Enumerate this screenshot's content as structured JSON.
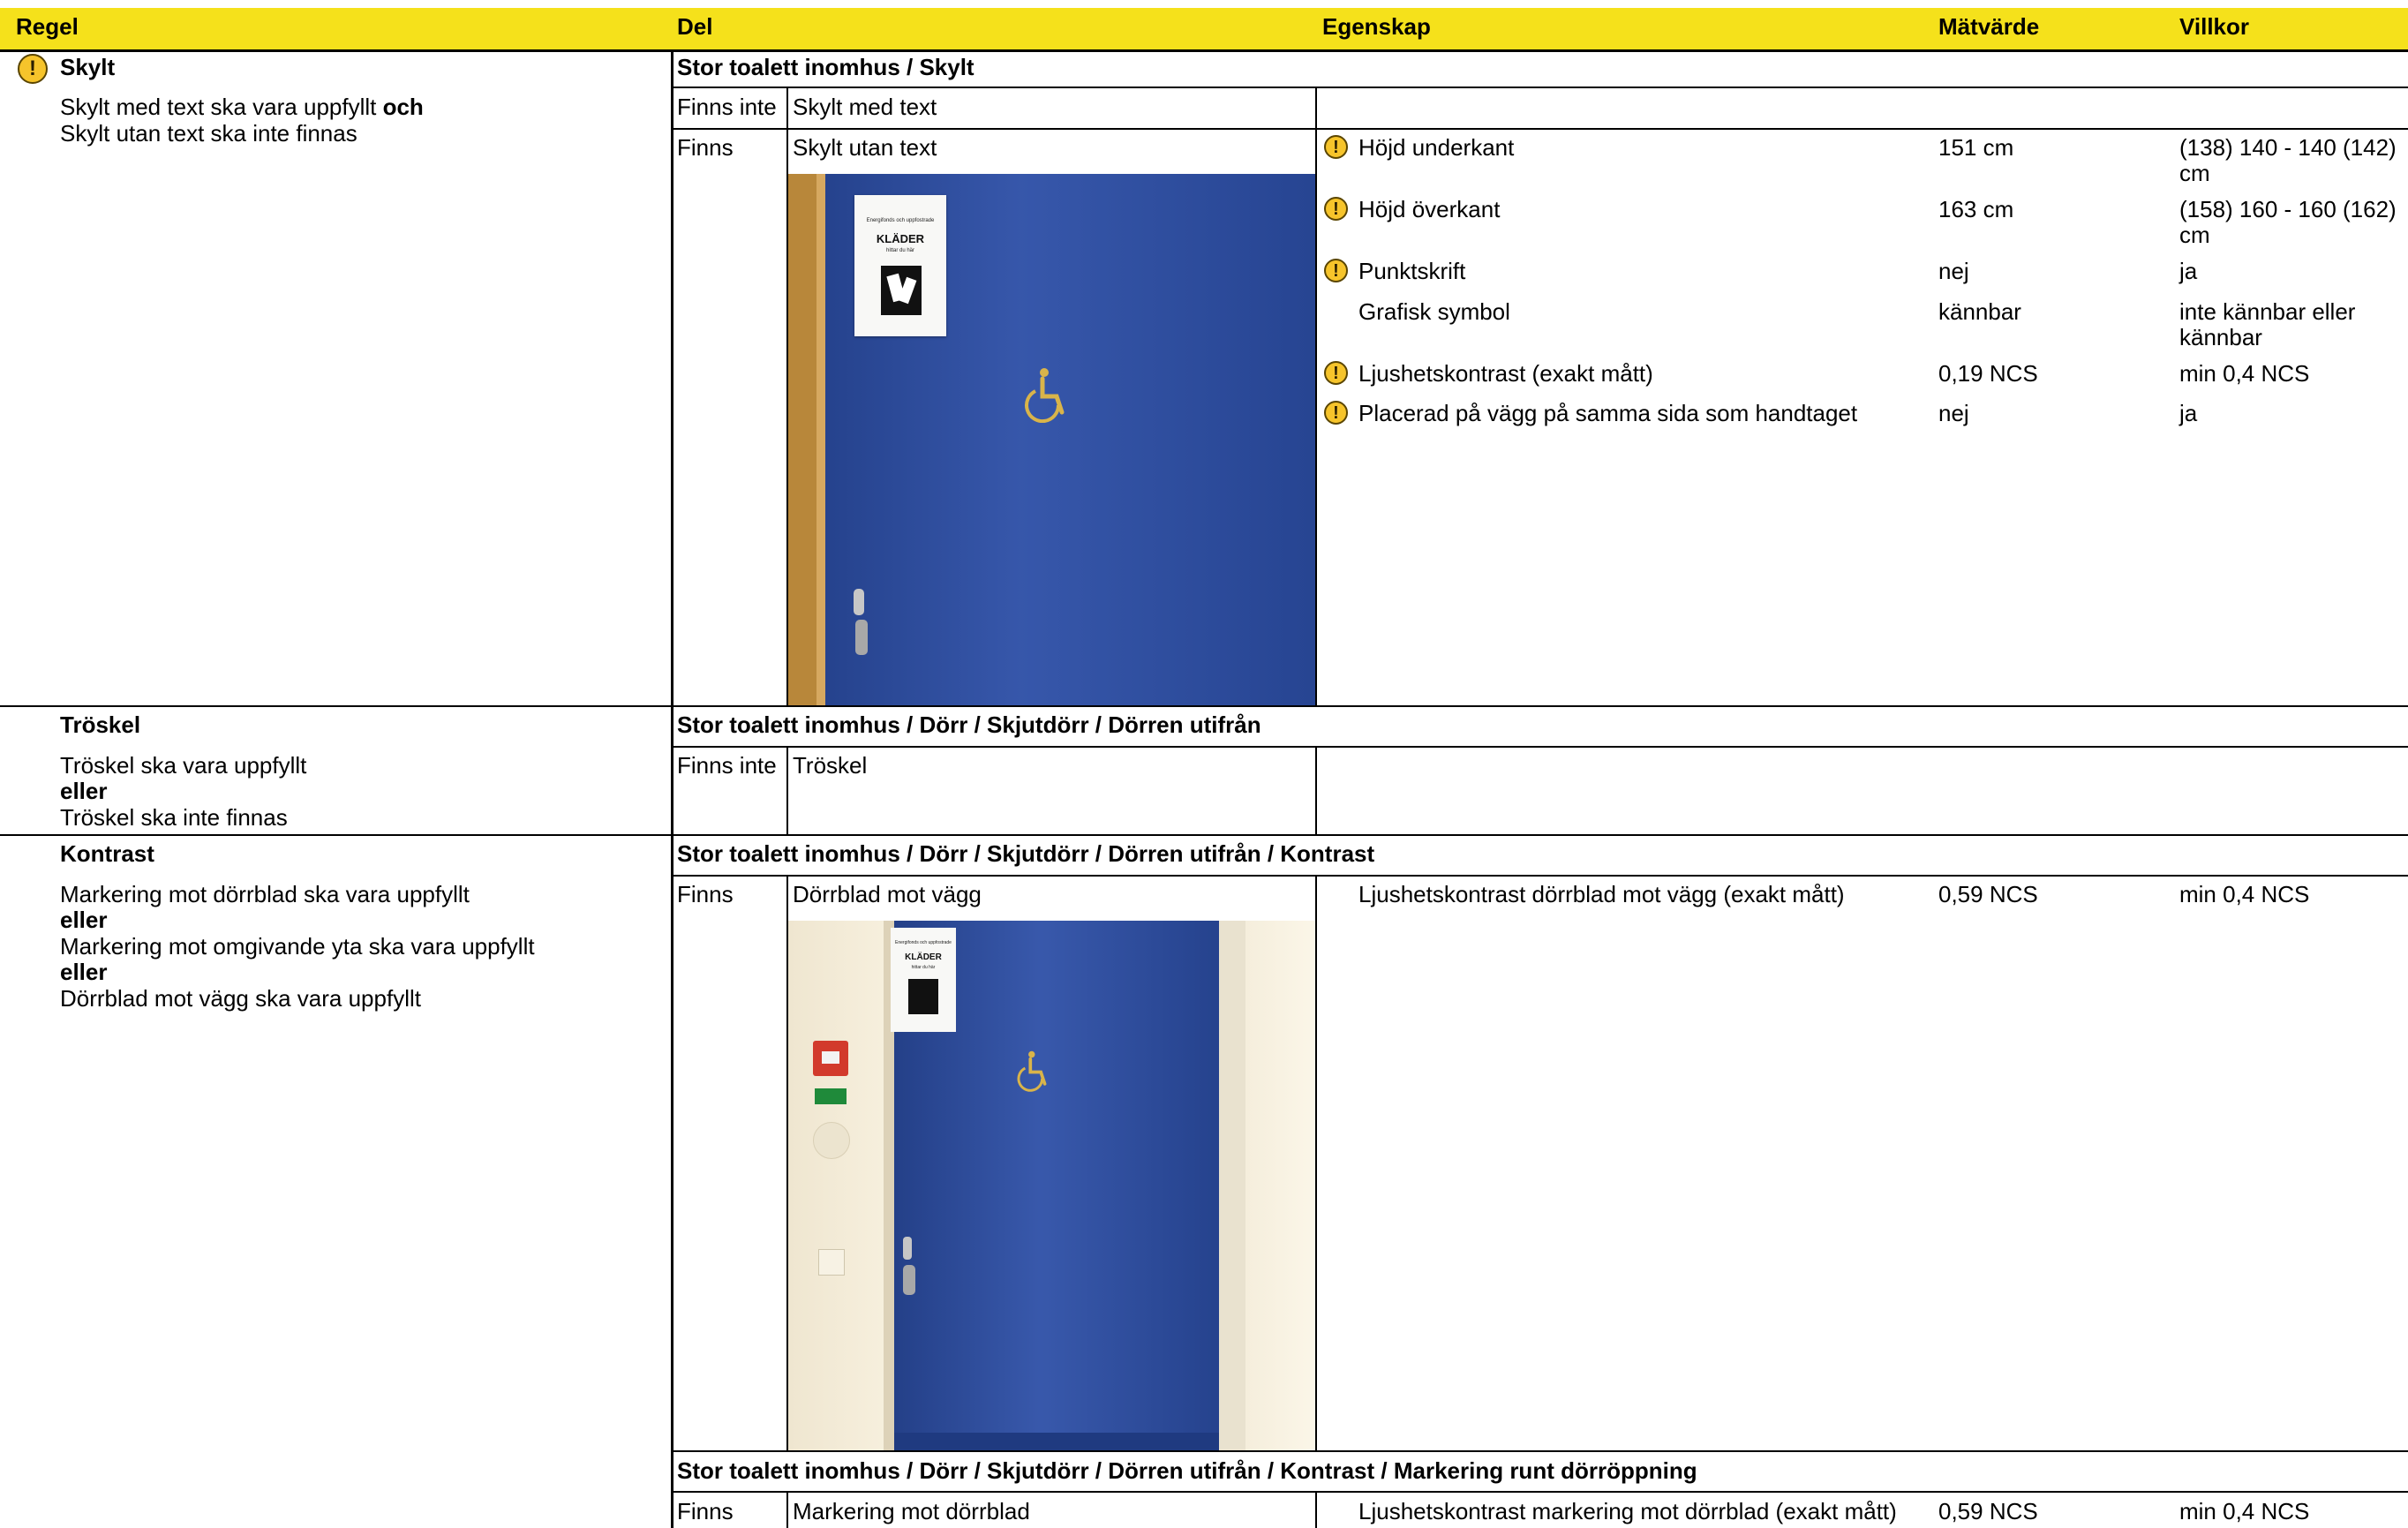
{
  "header": {
    "regel": "Regel",
    "del": "Del",
    "egenskap": "Egenskap",
    "matvarde": "Mätvärde",
    "villkor": "Villkor"
  },
  "rules": {
    "skylt": {
      "title": "Skylt",
      "line1_a": "Skylt med text ska vara uppfyllt ",
      "line1_b": "och",
      "line2": "Skylt utan text ska inte finnas"
    },
    "troskel": {
      "title": "Tröskel",
      "line1": "Tröskel ska vara uppfyllt",
      "line2": "eller",
      "line3": "Tröskel ska inte finnas"
    },
    "kontrast": {
      "title": "Kontrast",
      "line1": "Markering mot dörrblad ska vara uppfyllt",
      "line2": "eller",
      "line3": "Markering mot omgivande yta ska vara uppfyllt",
      "line4": "eller",
      "line5": "Dörrblad mot vägg ska vara uppfyllt"
    }
  },
  "sections": {
    "skylt": {
      "path": "Stor toalett inomhus / Skylt",
      "row1": {
        "status": "Finns inte",
        "part": "Skylt med text"
      },
      "row2": {
        "status": "Finns",
        "part": "Skylt utan text"
      },
      "properties": [
        {
          "name": "Höjd underkant",
          "value": "151 cm",
          "cond1": "(138) 140 - 140 (142)",
          "cond2": "cm",
          "warn": true
        },
        {
          "name": "Höjd överkant",
          "value": "163 cm",
          "cond1": "(158) 160 - 160 (162)",
          "cond2": "cm",
          "warn": true
        },
        {
          "name": "Punktskrift",
          "value": "nej",
          "cond1": "ja",
          "cond2": "",
          "warn": true
        },
        {
          "name": "Grafisk symbol",
          "value": "kännbar",
          "cond1": "inte kännbar eller",
          "cond2": "kännbar",
          "warn": false
        },
        {
          "name": "Ljushetskontrast (exakt mått)",
          "value": "0,19 NCS",
          "cond1": "min 0,4 NCS",
          "cond2": "",
          "warn": true
        },
        {
          "name": "Placerad på vägg på samma sida som handtaget",
          "value": "nej",
          "cond1": "ja",
          "cond2": "",
          "warn": true
        }
      ]
    },
    "troskel": {
      "path": "Stor toalett inomhus / Dörr / Skjutdörr / Dörren utifrån",
      "row1": {
        "status": "Finns inte",
        "part": "Tröskel"
      }
    },
    "kontrast": {
      "path": "Stor toalett inomhus / Dörr / Skjutdörr / Dörren utifrån / Kontrast",
      "row1": {
        "status": "Finns",
        "part": "Dörrblad mot vägg"
      },
      "property": {
        "name": "Ljushetskontrast dörrblad mot vägg (exakt mått)",
        "value": "0,59 NCS",
        "cond": "min 0,4 NCS"
      }
    },
    "markering": {
      "path": "Stor toalett inomhus / Dörr / Skjutdörr / Dörren utifrån / Kontrast / Markering runt dörröppning",
      "row1": {
        "status": "Finns",
        "part": "Markering mot dörrblad"
      },
      "property": {
        "name": "Ljushetskontrast markering mot dörrblad (exakt mått)",
        "value": "0,59 NCS",
        "cond": "min 0,4 NCS"
      }
    }
  },
  "photos": {
    "sign_small": "Energifonds och uppfostrade",
    "sign_big": "KLÄDER",
    "sign_sub": "hittar du här"
  },
  "icons": {
    "warning": "!",
    "warning_name": "warning-icon"
  },
  "colors": {
    "header": "#f5e11b",
    "door": "#2c4ea6",
    "warning": "#f6c42b"
  }
}
